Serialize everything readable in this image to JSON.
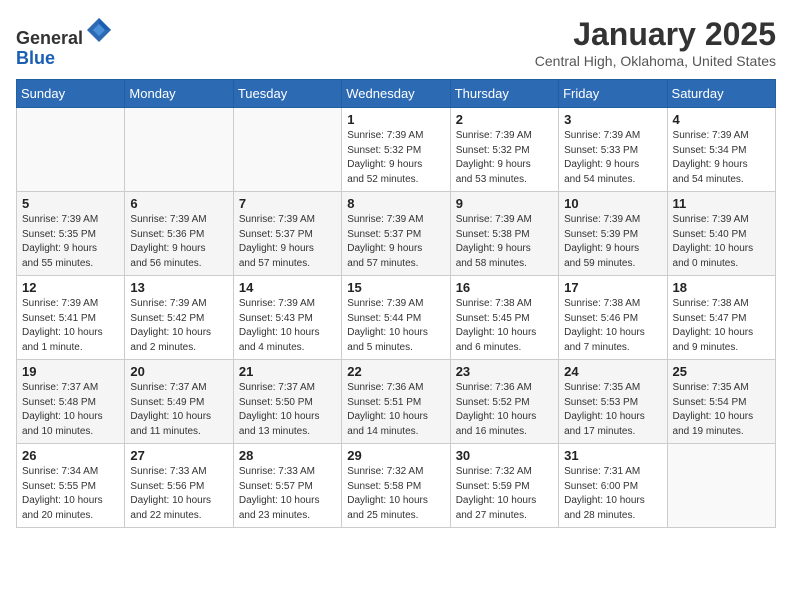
{
  "header": {
    "logo_line1": "General",
    "logo_line2": "Blue",
    "month": "January 2025",
    "location": "Central High, Oklahoma, United States"
  },
  "weekdays": [
    "Sunday",
    "Monday",
    "Tuesday",
    "Wednesday",
    "Thursday",
    "Friday",
    "Saturday"
  ],
  "weeks": [
    [
      {
        "day": "",
        "info": ""
      },
      {
        "day": "",
        "info": ""
      },
      {
        "day": "",
        "info": ""
      },
      {
        "day": "1",
        "info": "Sunrise: 7:39 AM\nSunset: 5:32 PM\nDaylight: 9 hours\nand 52 minutes."
      },
      {
        "day": "2",
        "info": "Sunrise: 7:39 AM\nSunset: 5:32 PM\nDaylight: 9 hours\nand 53 minutes."
      },
      {
        "day": "3",
        "info": "Sunrise: 7:39 AM\nSunset: 5:33 PM\nDaylight: 9 hours\nand 54 minutes."
      },
      {
        "day": "4",
        "info": "Sunrise: 7:39 AM\nSunset: 5:34 PM\nDaylight: 9 hours\nand 54 minutes."
      }
    ],
    [
      {
        "day": "5",
        "info": "Sunrise: 7:39 AM\nSunset: 5:35 PM\nDaylight: 9 hours\nand 55 minutes."
      },
      {
        "day": "6",
        "info": "Sunrise: 7:39 AM\nSunset: 5:36 PM\nDaylight: 9 hours\nand 56 minutes."
      },
      {
        "day": "7",
        "info": "Sunrise: 7:39 AM\nSunset: 5:37 PM\nDaylight: 9 hours\nand 57 minutes."
      },
      {
        "day": "8",
        "info": "Sunrise: 7:39 AM\nSunset: 5:37 PM\nDaylight: 9 hours\nand 57 minutes."
      },
      {
        "day": "9",
        "info": "Sunrise: 7:39 AM\nSunset: 5:38 PM\nDaylight: 9 hours\nand 58 minutes."
      },
      {
        "day": "10",
        "info": "Sunrise: 7:39 AM\nSunset: 5:39 PM\nDaylight: 9 hours\nand 59 minutes."
      },
      {
        "day": "11",
        "info": "Sunrise: 7:39 AM\nSunset: 5:40 PM\nDaylight: 10 hours\nand 0 minutes."
      }
    ],
    [
      {
        "day": "12",
        "info": "Sunrise: 7:39 AM\nSunset: 5:41 PM\nDaylight: 10 hours\nand 1 minute."
      },
      {
        "day": "13",
        "info": "Sunrise: 7:39 AM\nSunset: 5:42 PM\nDaylight: 10 hours\nand 2 minutes."
      },
      {
        "day": "14",
        "info": "Sunrise: 7:39 AM\nSunset: 5:43 PM\nDaylight: 10 hours\nand 4 minutes."
      },
      {
        "day": "15",
        "info": "Sunrise: 7:39 AM\nSunset: 5:44 PM\nDaylight: 10 hours\nand 5 minutes."
      },
      {
        "day": "16",
        "info": "Sunrise: 7:38 AM\nSunset: 5:45 PM\nDaylight: 10 hours\nand 6 minutes."
      },
      {
        "day": "17",
        "info": "Sunrise: 7:38 AM\nSunset: 5:46 PM\nDaylight: 10 hours\nand 7 minutes."
      },
      {
        "day": "18",
        "info": "Sunrise: 7:38 AM\nSunset: 5:47 PM\nDaylight: 10 hours\nand 9 minutes."
      }
    ],
    [
      {
        "day": "19",
        "info": "Sunrise: 7:37 AM\nSunset: 5:48 PM\nDaylight: 10 hours\nand 10 minutes."
      },
      {
        "day": "20",
        "info": "Sunrise: 7:37 AM\nSunset: 5:49 PM\nDaylight: 10 hours\nand 11 minutes."
      },
      {
        "day": "21",
        "info": "Sunrise: 7:37 AM\nSunset: 5:50 PM\nDaylight: 10 hours\nand 13 minutes."
      },
      {
        "day": "22",
        "info": "Sunrise: 7:36 AM\nSunset: 5:51 PM\nDaylight: 10 hours\nand 14 minutes."
      },
      {
        "day": "23",
        "info": "Sunrise: 7:36 AM\nSunset: 5:52 PM\nDaylight: 10 hours\nand 16 minutes."
      },
      {
        "day": "24",
        "info": "Sunrise: 7:35 AM\nSunset: 5:53 PM\nDaylight: 10 hours\nand 17 minutes."
      },
      {
        "day": "25",
        "info": "Sunrise: 7:35 AM\nSunset: 5:54 PM\nDaylight: 10 hours\nand 19 minutes."
      }
    ],
    [
      {
        "day": "26",
        "info": "Sunrise: 7:34 AM\nSunset: 5:55 PM\nDaylight: 10 hours\nand 20 minutes."
      },
      {
        "day": "27",
        "info": "Sunrise: 7:33 AM\nSunset: 5:56 PM\nDaylight: 10 hours\nand 22 minutes."
      },
      {
        "day": "28",
        "info": "Sunrise: 7:33 AM\nSunset: 5:57 PM\nDaylight: 10 hours\nand 23 minutes."
      },
      {
        "day": "29",
        "info": "Sunrise: 7:32 AM\nSunset: 5:58 PM\nDaylight: 10 hours\nand 25 minutes."
      },
      {
        "day": "30",
        "info": "Sunrise: 7:32 AM\nSunset: 5:59 PM\nDaylight: 10 hours\nand 27 minutes."
      },
      {
        "day": "31",
        "info": "Sunrise: 7:31 AM\nSunset: 6:00 PM\nDaylight: 10 hours\nand 28 minutes."
      },
      {
        "day": "",
        "info": ""
      }
    ]
  ]
}
